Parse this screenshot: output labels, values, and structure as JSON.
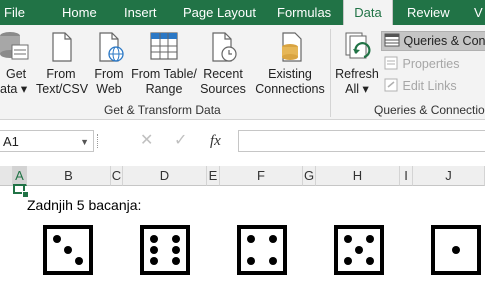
{
  "ribbon": {
    "tabs": [
      {
        "label": "File",
        "active": false
      },
      {
        "label": "Home",
        "active": false
      },
      {
        "label": "Insert",
        "active": false
      },
      {
        "label": "Page Layout",
        "active": false
      },
      {
        "label": "Formulas",
        "active": false
      },
      {
        "label": "Data",
        "active": true
      },
      {
        "label": "Review",
        "active": false
      },
      {
        "label": "V",
        "active": false
      }
    ],
    "get_transform": {
      "get_data": {
        "line1": "Get",
        "line2": "ata ▾"
      },
      "from_text_csv": {
        "line1": "From",
        "line2": "Text/CSV"
      },
      "from_web": {
        "line1": "From",
        "line2": "Web"
      },
      "from_table_range": {
        "line1": "From Table/",
        "line2": "Range"
      },
      "recent_sources": {
        "line1": "Recent",
        "line2": "Sources"
      },
      "existing_connections": {
        "line1": "Existing",
        "line2": "Connections"
      },
      "group_label": "Get & Transform Data"
    },
    "queries": {
      "refresh_all": {
        "line1": "Refresh",
        "line2": "All ▾"
      },
      "queries_connections": "Queries & Conn",
      "properties": "Properties",
      "edit_links": "Edit Links",
      "group_label": "Queries & Connectio"
    }
  },
  "formula_bar": {
    "name_box": "A1",
    "fx_label": "fx",
    "value": ""
  },
  "grid": {
    "columns": [
      "A",
      "B",
      "C",
      "D",
      "E",
      "F",
      "G",
      "H",
      "I",
      "J"
    ],
    "selected_column": "A",
    "cell_B2": "Zadnjih 5 bacanja:"
  },
  "dice": [
    3,
    6,
    4,
    5,
    1
  ],
  "colors": {
    "brand": "#217346",
    "ribbon_bg": "#f3f3f3"
  }
}
